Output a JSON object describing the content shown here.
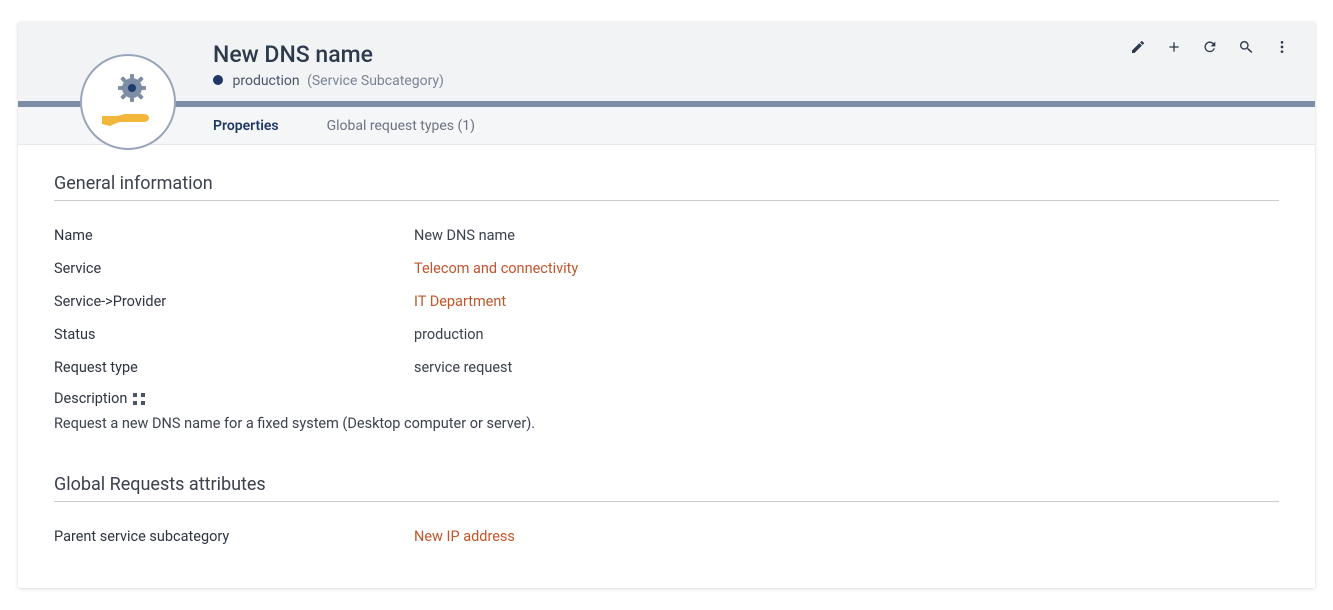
{
  "header": {
    "title": "New DNS name",
    "status_text": "production",
    "subtype_text": "(Service Subcategory)"
  },
  "toolbar": {
    "edit": "edit",
    "add": "add",
    "refresh": "refresh",
    "search": "search",
    "more": "more"
  },
  "tabs": {
    "properties": "Properties",
    "global_request_types": "Global request types (1)"
  },
  "section_general": {
    "title": "General information",
    "fields": {
      "name": {
        "label": "Name",
        "value": "New DNS name",
        "link": false
      },
      "service": {
        "label": "Service",
        "value": "Telecom and connectivity",
        "link": true
      },
      "provider": {
        "label": "Service->Provider",
        "value": "IT Department",
        "link": true
      },
      "status": {
        "label": "Status",
        "value": "production",
        "link": false
      },
      "request_type": {
        "label": "Request type",
        "value": "service request",
        "link": false
      }
    },
    "description": {
      "label": "Description",
      "text": "Request a new DNS name for a fixed system (Desktop computer or server)."
    }
  },
  "section_global": {
    "title": "Global Requests attributes",
    "fields": {
      "parent_subcat": {
        "label": "Parent service subcategory",
        "value": "New IP address",
        "link": true
      }
    }
  }
}
